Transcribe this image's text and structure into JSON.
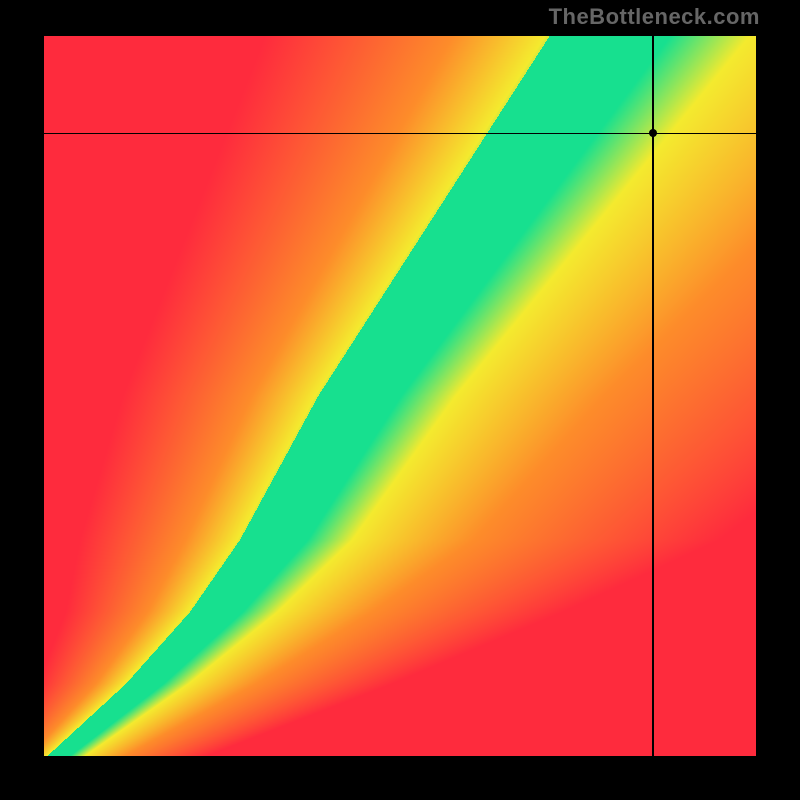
{
  "watermark": "TheBottleneck.com",
  "chart_data": {
    "type": "heatmap",
    "title": "",
    "xlabel": "",
    "ylabel": "",
    "xlim": [
      0,
      100
    ],
    "ylim": [
      0,
      100
    ],
    "grid": false,
    "data_point": {
      "x": 85.5,
      "y": 86.5
    },
    "crosshair": {
      "x": 85.5,
      "y": 86.5
    },
    "optimal_curve": {
      "description": "green band center from bottom-left to top; x as function of y (percent of axis)",
      "y": [
        0,
        10,
        20,
        30,
        40,
        50,
        60,
        70,
        80,
        90,
        100
      ],
      "x": [
        2,
        14,
        24,
        32,
        38,
        44,
        51,
        58,
        65,
        72,
        79
      ]
    },
    "band_halfwidth_x": {
      "y": [
        0,
        10,
        20,
        30,
        40,
        50,
        60,
        70,
        80,
        90,
        100
      ],
      "hw": [
        1.5,
        2.5,
        3.5,
        4.5,
        5.0,
        5.5,
        6.0,
        6.5,
        7.0,
        7.5,
        8.0
      ]
    },
    "colorscale_note": "green in band, yellow near band, orange mid, red far; asymmetric: right-of-band stays orange/yellow longer than left-of-band",
    "colors": {
      "green": "#17e08f",
      "yellow": "#f4ea2e",
      "orange": "#fd8c2a",
      "red": "#fe2b3d"
    }
  }
}
